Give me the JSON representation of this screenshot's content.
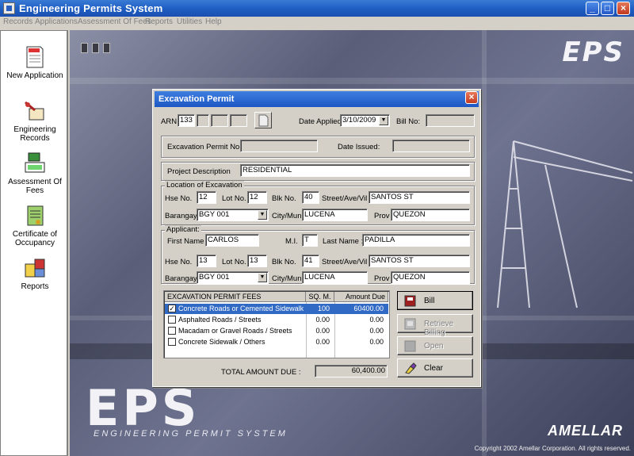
{
  "window": {
    "title": "Engineering Permits System"
  },
  "menu": [
    "Records",
    "Applications",
    "Assessment Of Fees",
    "Reports",
    "Utilities",
    "Help"
  ],
  "sidebar": [
    {
      "label": "New Application",
      "icon": "document-icon"
    },
    {
      "label": "Engineering Records",
      "icon": "records-icon"
    },
    {
      "label": "Assessment Of Fees",
      "icon": "calculator-icon"
    },
    {
      "label": "Certificate of Occupancy",
      "icon": "certificate-icon"
    },
    {
      "label": "Reports",
      "icon": "reports-icon"
    }
  ],
  "background": {
    "logo_top": "EPS",
    "logo_big": "EPS",
    "subtitle": "ENGINEERING PERMIT SYSTEM",
    "company": "AMELLAR",
    "copyright": "Copyright 2002 Amellar Corporation.  All rights reserved."
  },
  "dialog": {
    "title": "Excavation Permit",
    "arn_label": "ARN",
    "arn_value": "133",
    "date_applied_label": "Date Applied:",
    "date_applied_value": "3/10/2009",
    "bill_no_label": "Bill No:",
    "bill_no_value": "",
    "permit_no_label": "Excavation Permit No:",
    "permit_no_value": "",
    "date_issued_label": "Date Issued:",
    "date_issued_value": "",
    "project_description_label": "Project Description",
    "project_description_value": "RESIDENTIAL",
    "location": {
      "group_label": "Location of Excavation",
      "hse_no_label": "Hse No.",
      "hse_no": "12",
      "lot_no_label": "Lot No.",
      "lot_no": "12",
      "blk_no_label": "Blk No.",
      "blk_no": "40",
      "street_label": "Street/Ave/Vil",
      "street": "SANTOS ST",
      "barangay_label": "Barangay",
      "barangay": "BGY 001",
      "city_label": "City/Mun",
      "city": "LUCENA",
      "prov_label": "Prov",
      "prov": "QUEZON"
    },
    "applicant": {
      "group_label": "Applicant:",
      "first_name_label": "First Name :",
      "first_name": "CARLOS",
      "mi_label": "M.I.",
      "mi": "T",
      "last_name_label": "Last Name :",
      "last_name": "PADILLA",
      "hse_no_label": "Hse No.",
      "hse_no": "13",
      "lot_no_label": "Lot No.",
      "lot_no": "13",
      "blk_no_label": "Blk No.",
      "blk_no": "41",
      "street_label": "Street/Ave/Vil",
      "street": "SANTOS ST",
      "barangay_label": "Barangay",
      "barangay": "BGY 001",
      "city_label": "City/Mun",
      "city": "LUCENA",
      "prov_label": "Prov",
      "prov": "QUEZON"
    },
    "fees": {
      "col_fee": "EXCAVATION PERMIT FEES",
      "col_sqm": "SQ. M.",
      "col_amount": "Amount Due",
      "rows": [
        {
          "checked": true,
          "name": "Concrete Roads or Cemented Sidewalk",
          "sqm": "100",
          "amount": "60400.00"
        },
        {
          "checked": false,
          "name": "Asphalted Roads / Streets",
          "sqm": "0.00",
          "amount": "0.00"
        },
        {
          "checked": false,
          "name": "Macadam or Gravel Roads / Streets",
          "sqm": "0.00",
          "amount": "0.00"
        },
        {
          "checked": false,
          "name": "Concrete Sidewalk / Others",
          "sqm": "0.00",
          "amount": "0.00"
        }
      ],
      "total_label": "TOTAL AMOUNT DUE :",
      "total_value": "60,400.00"
    },
    "buttons": {
      "bill": "Bill",
      "retrieve_billing": "Retrieve Billing",
      "open": "Open",
      "clear": "Clear"
    }
  }
}
